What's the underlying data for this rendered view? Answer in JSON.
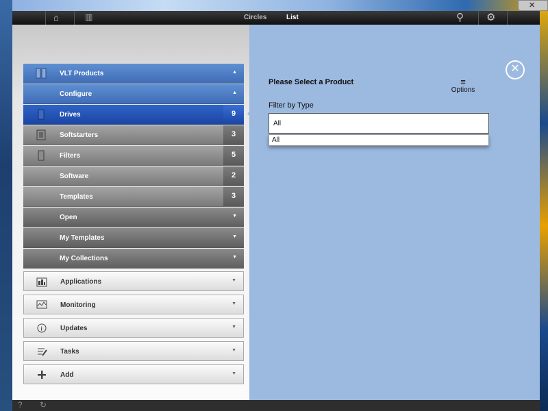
{
  "topbar": {
    "tabs": [
      {
        "label": "Circles",
        "active": false
      },
      {
        "label": "List",
        "active": true
      }
    ],
    "icons": [
      "home-icon",
      "grid-icon",
      "search-icon",
      "gear-icon"
    ]
  },
  "sidebar": {
    "header": {
      "label": "VLT Products"
    },
    "configure": {
      "label": "Configure"
    },
    "items": [
      {
        "label": "Drives",
        "count": "9",
        "selected": true
      },
      {
        "label": "Softstarters",
        "count": "3"
      },
      {
        "label": "Filters",
        "count": "5"
      },
      {
        "label": "Software",
        "count": "2"
      },
      {
        "label": "Templates",
        "count": "3"
      }
    ],
    "groups": [
      {
        "label": "Open"
      },
      {
        "label": "My Templates"
      },
      {
        "label": "My Collections"
      }
    ],
    "sections": [
      {
        "label": "Applications",
        "icon": "applications-icon"
      },
      {
        "label": "Monitoring",
        "icon": "monitoring-icon"
      },
      {
        "label": "Updates",
        "icon": "updates-icon"
      },
      {
        "label": "Tasks",
        "icon": "tasks-icon"
      },
      {
        "label": "Add",
        "icon": "plus-icon"
      }
    ]
  },
  "main": {
    "title": "Please Select a Product",
    "options_label": "Options",
    "filter_label": "Filter by Type",
    "filter_value": "All",
    "filter_options": [
      "All"
    ]
  },
  "colors": {
    "panel_blue": "#9cb9e0",
    "nav_blue": "#4f7fc6",
    "nav_selected": "#1f4db0"
  }
}
